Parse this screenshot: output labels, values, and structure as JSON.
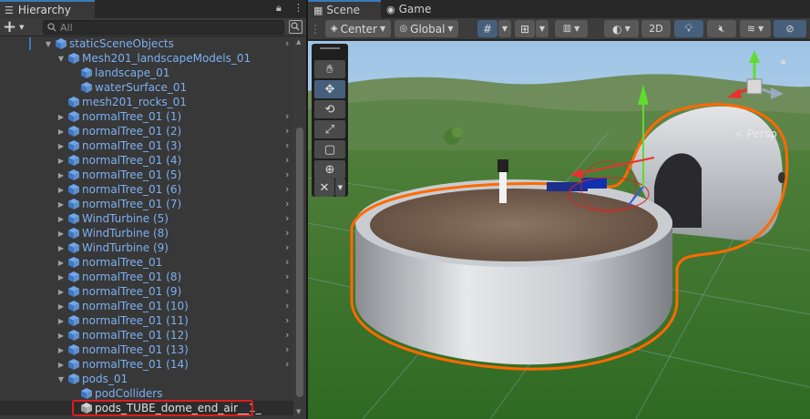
{
  "hierarchy": {
    "tab_label": "Hierarchy",
    "lock_icon": "lock-icon",
    "menu_icon": "kebab-menu-icon",
    "add_label": "+",
    "search_placeholder": "All",
    "rows": [
      {
        "label": "staticSceneObjects",
        "indent": 0,
        "expanded": true,
        "chev": true
      },
      {
        "label": "Mesh201_landscapeModels_01",
        "indent": 1,
        "expanded": true,
        "chev": false
      },
      {
        "label": "landscape_01",
        "indent": 2,
        "expanded": null,
        "chev": false
      },
      {
        "label": "waterSurface_01",
        "indent": 2,
        "expanded": null,
        "chev": false
      },
      {
        "label": "mesh201_rocks_01",
        "indent": 1,
        "expanded": null,
        "chev": false
      },
      {
        "label": "normalTree_01 (1)",
        "indent": 1,
        "expanded": false,
        "chev": true
      },
      {
        "label": "normalTree_01 (2)",
        "indent": 1,
        "expanded": false,
        "chev": true
      },
      {
        "label": "normalTree_01 (3)",
        "indent": 1,
        "expanded": false,
        "chev": true
      },
      {
        "label": "normalTree_01 (4)",
        "indent": 1,
        "expanded": false,
        "chev": true
      },
      {
        "label": "normalTree_01 (5)",
        "indent": 1,
        "expanded": false,
        "chev": true
      },
      {
        "label": "normalTree_01 (6)",
        "indent": 1,
        "expanded": false,
        "chev": true
      },
      {
        "label": "normalTree_01 (7)",
        "indent": 1,
        "expanded": false,
        "chev": true
      },
      {
        "label": "WindTurbine (5)",
        "indent": 1,
        "expanded": false,
        "chev": true
      },
      {
        "label": "WindTurbine (8)",
        "indent": 1,
        "expanded": false,
        "chev": true
      },
      {
        "label": "WindTurbine (9)",
        "indent": 1,
        "expanded": false,
        "chev": true
      },
      {
        "label": "normalTree_01",
        "indent": 1,
        "expanded": false,
        "chev": true
      },
      {
        "label": "normalTree_01 (8)",
        "indent": 1,
        "expanded": false,
        "chev": true
      },
      {
        "label": "normalTree_01 (9)",
        "indent": 1,
        "expanded": false,
        "chev": true
      },
      {
        "label": "normalTree_01 (10)",
        "indent": 1,
        "expanded": false,
        "chev": true
      },
      {
        "label": "normalTree_01 (11)",
        "indent": 1,
        "expanded": false,
        "chev": true
      },
      {
        "label": "normalTree_01 (12)",
        "indent": 1,
        "expanded": false,
        "chev": true
      },
      {
        "label": "normalTree_01 (13)",
        "indent": 1,
        "expanded": false,
        "chev": true
      },
      {
        "label": "normalTree_01 (14)",
        "indent": 1,
        "expanded": false,
        "chev": true
      },
      {
        "label": "pods_01",
        "indent": 1,
        "expanded": true,
        "chev": false
      },
      {
        "label": "podColliders",
        "indent": 2,
        "expanded": null,
        "chev": false
      },
      {
        "label": "pods_TUBE_dome_end_air__1_",
        "indent": 2,
        "expanded": null,
        "chev": false,
        "selected": true
      }
    ]
  },
  "scene": {
    "tabs": [
      "Scene",
      "Game"
    ],
    "pivot_mode": "Center",
    "pivot_rotation": "Global",
    "mode_2d": "2D",
    "persp_label": "< Persp",
    "colors": {
      "accent": "#3a79bb",
      "selection_outline": "#ff6a00",
      "highlight_box": "#e01c1c",
      "tree_text": "#7cb0f2",
      "gizmo_y": "#5fdc2f",
      "gizmo_x": "#e8322f",
      "gizmo_z": "#2f5de8"
    }
  }
}
